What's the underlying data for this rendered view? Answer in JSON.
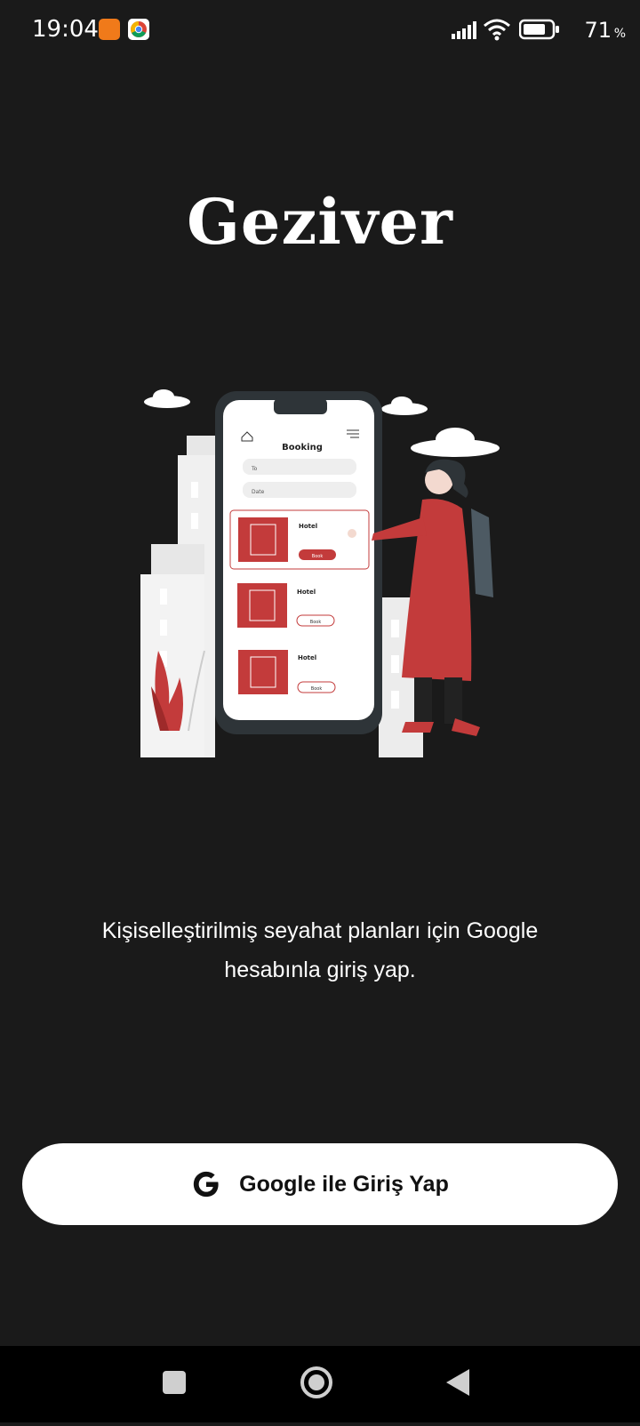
{
  "status_bar": {
    "time": "19:04",
    "battery_level": "71",
    "battery_unit": "%",
    "icons": [
      "gallery-app-icon",
      "chrome-icon",
      "signal-icon",
      "wifi-icon",
      "battery-icon"
    ]
  },
  "app": {
    "title": "Geziver",
    "tagline": "Kişiselleştirilmiş seyahat planları için Google hesabınla giriş yap.",
    "sign_in_label": "Google ile Giriş Yap"
  },
  "illustration": {
    "heading": "Booking",
    "to_label": "To",
    "date_label": "Date",
    "hotel_label": "Hotel",
    "book_label": "Book"
  },
  "navigation": {
    "buttons": [
      "recents-button",
      "home-button",
      "back-button"
    ]
  },
  "colors": {
    "background": "#1a1a1a",
    "accent": "#c33b3b",
    "button_bg": "#ffffff"
  }
}
